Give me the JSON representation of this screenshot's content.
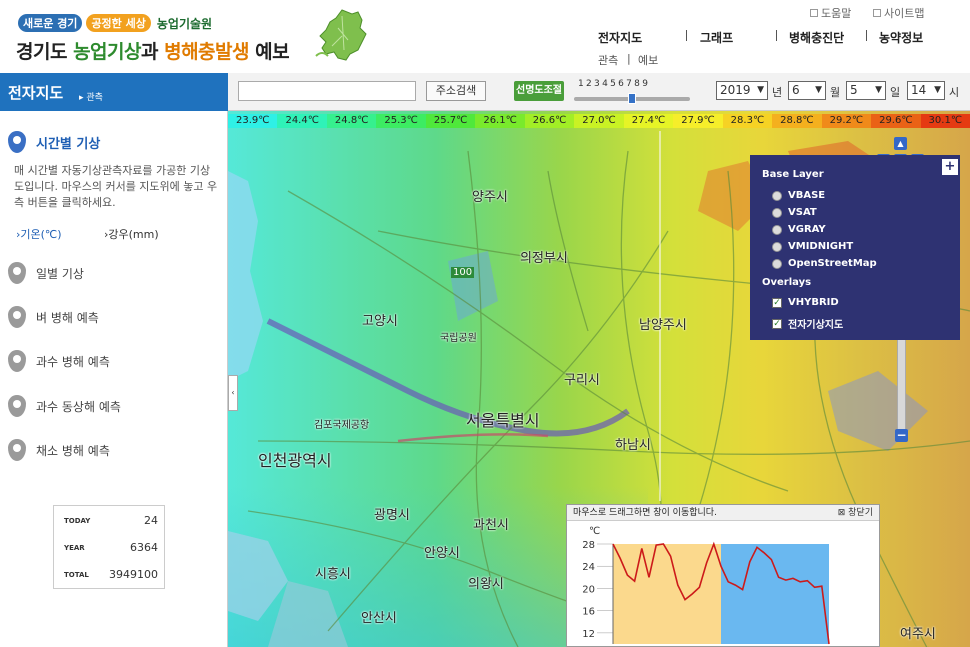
{
  "header": {
    "tag1": "새로운 경기",
    "tag2": "공정한 세상",
    "org": "농업기술원",
    "title_part1": "경기도 ",
    "title_part2": "농업기상",
    "title_part3": "과 ",
    "title_part4": "병해충발생",
    "title_part5": " 예보",
    "util": [
      "도움말",
      "사이트맵"
    ],
    "nav": [
      "전자지도",
      "그래프",
      "병해충진단",
      "농약정보"
    ],
    "sub_nav": [
      "관측",
      "예보"
    ]
  },
  "pagebar": {
    "title": "전자지도",
    "crumb": "▸ 관측"
  },
  "toolbar": {
    "address_placeholder": "",
    "search_button": "주소검색",
    "transparency_button": "선명도조절",
    "slider_numbers": "123456789",
    "slider_value": 5,
    "year": "2019",
    "year_unit": "년",
    "month": "6",
    "month_unit": "월",
    "day": "5",
    "day_unit": "일",
    "hour": "14",
    "hour_unit": "시"
  },
  "sidebar": {
    "items": [
      {
        "label": "시간별 기상",
        "active": true
      },
      {
        "label": "일별 기상",
        "active": false
      },
      {
        "label": "벼 병해 예측",
        "active": false
      },
      {
        "label": "과수 병해 예측",
        "active": false
      },
      {
        "label": "과수 동상해 예측",
        "active": false
      },
      {
        "label": "채소 병해 예측",
        "active": false
      }
    ],
    "description": "매 시간별 자동기상관측자료를 가공한 기상도입니다. 마우스의 커서를 지도위에 놓고 우측 버튼을 클릭하세요.",
    "sub_temp": "›기온(℃)",
    "sub_rain": "›강우(mm)",
    "toggle": "‹",
    "counter": {
      "today_label": "TODAY",
      "today": "24",
      "year_label": "YEAR",
      "year": "6364",
      "total_label": "TOTAL",
      "total": "3949100"
    }
  },
  "map": {
    "legend": [
      {
        "label": "23.9℃",
        "color": "#2ff0e6"
      },
      {
        "label": "24.4℃",
        "color": "#2ff2b8"
      },
      {
        "label": "24.8℃",
        "color": "#36f08e"
      },
      {
        "label": "25.3℃",
        "color": "#3cec62"
      },
      {
        "label": "25.7℃",
        "color": "#4fe83b"
      },
      {
        "label": "26.1℃",
        "color": "#79ea2c"
      },
      {
        "label": "26.6℃",
        "color": "#a2ee26"
      },
      {
        "label": "27.0℃",
        "color": "#c9f224"
      },
      {
        "label": "27.4℃",
        "color": "#e6f426"
      },
      {
        "label": "27.9℃",
        "color": "#f6ee2a"
      },
      {
        "label": "28.3℃",
        "color": "#f6d224"
      },
      {
        "label": "28.8℃",
        "color": "#f4b01e"
      },
      {
        "label": "29.2℃",
        "color": "#f08a1a"
      },
      {
        "label": "29.6℃",
        "color": "#ea6216"
      },
      {
        "label": "30.1℃",
        "color": "#e53a12"
      }
    ],
    "cities": [
      {
        "name": "양주시",
        "size": ""
      },
      {
        "name": "의정부시",
        "size": ""
      },
      {
        "name": "고양시",
        "size": ""
      },
      {
        "name": "남양주시",
        "size": ""
      },
      {
        "name": "구리시",
        "size": ""
      },
      {
        "name": "서울특별시",
        "size": "big"
      },
      {
        "name": "인천광역시",
        "size": "big"
      },
      {
        "name": "하남시",
        "size": ""
      },
      {
        "name": "광명시",
        "size": ""
      },
      {
        "name": "과천시",
        "size": ""
      },
      {
        "name": "안양시",
        "size": ""
      },
      {
        "name": "시흥시",
        "size": ""
      },
      {
        "name": "의왕시",
        "size": ""
      },
      {
        "name": "안산시",
        "size": ""
      },
      {
        "name": "여주시",
        "size": ""
      },
      {
        "name": "김포국제공항",
        "size": "small"
      },
      {
        "name": "국립공원",
        "size": "small"
      },
      {
        "name": "100",
        "size": "small"
      }
    ],
    "layer_panel": {
      "base_header": "Base Layer",
      "base_layers": [
        "VBASE",
        "VSAT",
        "VGRAY",
        "VMIDNIGHT",
        "OpenStreetMap"
      ],
      "overlay_header": "Overlays",
      "overlays": [
        {
          "label": "VHYBRID",
          "checked": true
        },
        {
          "label": "전자기상지도",
          "checked": true
        }
      ],
      "plus": "+"
    },
    "zoom": {
      "plus": "+",
      "minus": "−"
    }
  },
  "popup": {
    "title": "마우스로 드래그하면 창이 이동합니다.",
    "close": "창닫기",
    "unit": "℃",
    "yticks": [
      "28",
      "24",
      "20",
      "16",
      "12"
    ]
  },
  "chart_data": {
    "type": "line",
    "title": "",
    "xlabel": "",
    "ylabel": "℃",
    "ylim": [
      10,
      28
    ],
    "y_ticks": [
      12,
      16,
      20,
      24,
      28
    ],
    "background_bands": [
      {
        "from": 0,
        "to": 15,
        "color": "#fbd98d"
      },
      {
        "from": 15,
        "to": 30,
        "color": "#6ab8f0"
      }
    ],
    "series": [
      {
        "color": "#cc1a1a",
        "values": [
          28,
          25.4,
          22.4,
          21.3,
          27.2,
          22,
          27.8,
          28,
          25.8,
          20.6,
          18,
          19,
          20.2,
          24.6,
          28,
          24,
          21.2,
          20.6,
          19.8,
          24.8,
          27.4,
          26.4,
          25.2,
          22,
          21.5,
          21.8,
          21.2,
          21.4,
          20.2,
          20.4,
          10
        ]
      }
    ]
  }
}
